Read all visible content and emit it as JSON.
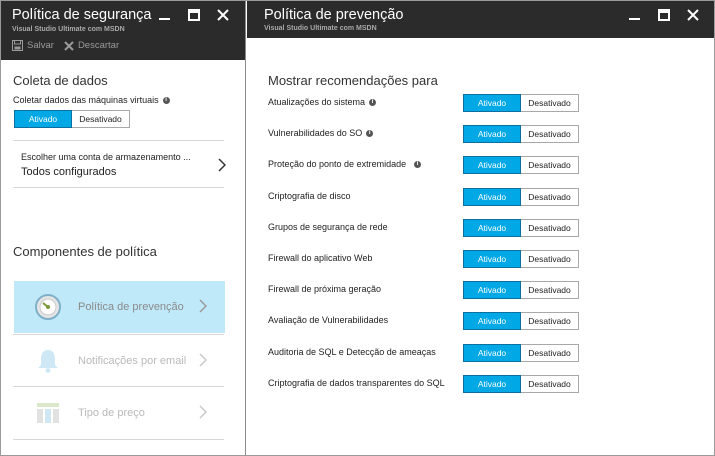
{
  "left_blade": {
    "title": "Política de segurança",
    "subtitle": "Visual Studio Ultimate com MSDN",
    "save_label": "Salvar",
    "discard_label": "Descartar",
    "data_collection": {
      "heading": "Coleta de dados",
      "label": "Coletar dados das máquinas virtuais",
      "on_label": "Ativado",
      "off_label": "Desativado",
      "state": "on"
    },
    "storage": {
      "label": "Escolher uma conta de armazenamento ...",
      "value": "Todos configurados"
    },
    "components": {
      "heading": "Componentes de política",
      "items": [
        {
          "label": "Política de prevenção",
          "icon": "gauge-icon",
          "active": true
        },
        {
          "label": "Notificações por email",
          "icon": "bell-icon",
          "active": false
        },
        {
          "label": "Tipo de preço",
          "icon": "pricing-icon",
          "active": false
        }
      ]
    }
  },
  "right_blade": {
    "title": "Política de prevenção",
    "subtitle": "Visual Studio Ultimate com MSDN",
    "heading": "Mostrar recomendações para",
    "on_label": "Ativado",
    "off_label": "Desativado",
    "recommendations": [
      {
        "label": "Atualizações do sistema",
        "info": true,
        "state": "on"
      },
      {
        "label": "Vulnerabilidades do SO",
        "info": true,
        "state": "on"
      },
      {
        "label": "Proteção do ponto de extremidade",
        "info": true,
        "state": "on"
      },
      {
        "label": "Criptografia de disco",
        "info": false,
        "state": "on"
      },
      {
        "label": "Grupos de segurança de rede",
        "info": false,
        "state": "on"
      },
      {
        "label": "Firewall do aplicativo Web",
        "info": false,
        "state": "on"
      },
      {
        "label": "Firewall de próxima geração",
        "info": false,
        "state": "on"
      },
      {
        "label": "Avaliação de Vulnerabilidades",
        "info": false,
        "state": "on"
      },
      {
        "label": "Auditoria de SQL e Detecção de ameaças",
        "info": false,
        "state": "on"
      },
      {
        "label": "Criptografia de dados transparentes do SQL",
        "info": false,
        "state": "on"
      }
    ]
  },
  "colors": {
    "header_bg": "#2b2b2b",
    "toggle_on": "#00a8e6",
    "active_item_bg": "#bfe8f9"
  }
}
